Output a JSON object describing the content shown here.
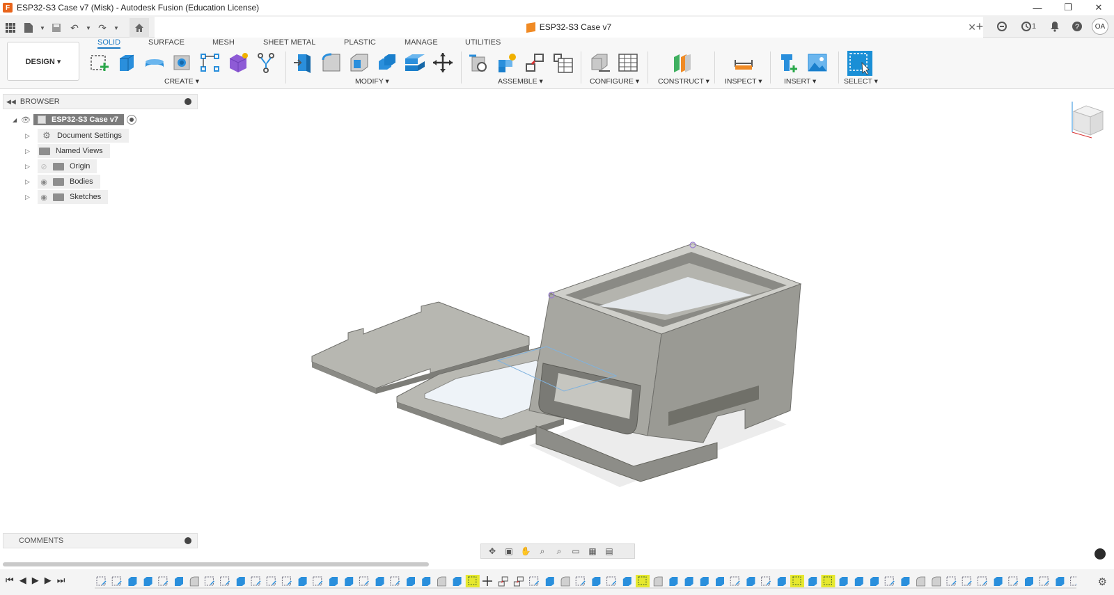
{
  "window": {
    "title": "ESP32-S3 Case v7 (Misk) - Autodesk Fusion (Education License)",
    "app_icon": "F",
    "controls": [
      "—",
      "❐",
      "✕"
    ]
  },
  "tabbar": {
    "document_tab": "ESP32-S3 Case v7",
    "close_symbol": "✕",
    "job_count": "1",
    "user_initials": "OA"
  },
  "ribbon": {
    "workspace": "DESIGN ▾",
    "tabs": [
      "SOLID",
      "SURFACE",
      "MESH",
      "SHEET METAL",
      "PLASTIC",
      "MANAGE",
      "UTILITIES"
    ],
    "groups": [
      "CREATE ▾",
      "MODIFY ▾",
      "ASSEMBLE ▾",
      "CONFIGURE ▾",
      "CONSTRUCT ▾",
      "INSPECT ▾",
      "INSERT ▾",
      "SELECT ▾"
    ]
  },
  "browser": {
    "title": "BROWSER",
    "root": "ESP32-S3 Case v7",
    "items": [
      "Document Settings",
      "Named Views",
      "Origin",
      "Bodies",
      "Sketches"
    ]
  },
  "comments": {
    "title": "COMMENTS"
  },
  "colors": {
    "accent": "#1a78c2",
    "model": "#8f8f8b",
    "model_light": "#b4b4ae",
    "select_active": "#1a8fd6"
  }
}
